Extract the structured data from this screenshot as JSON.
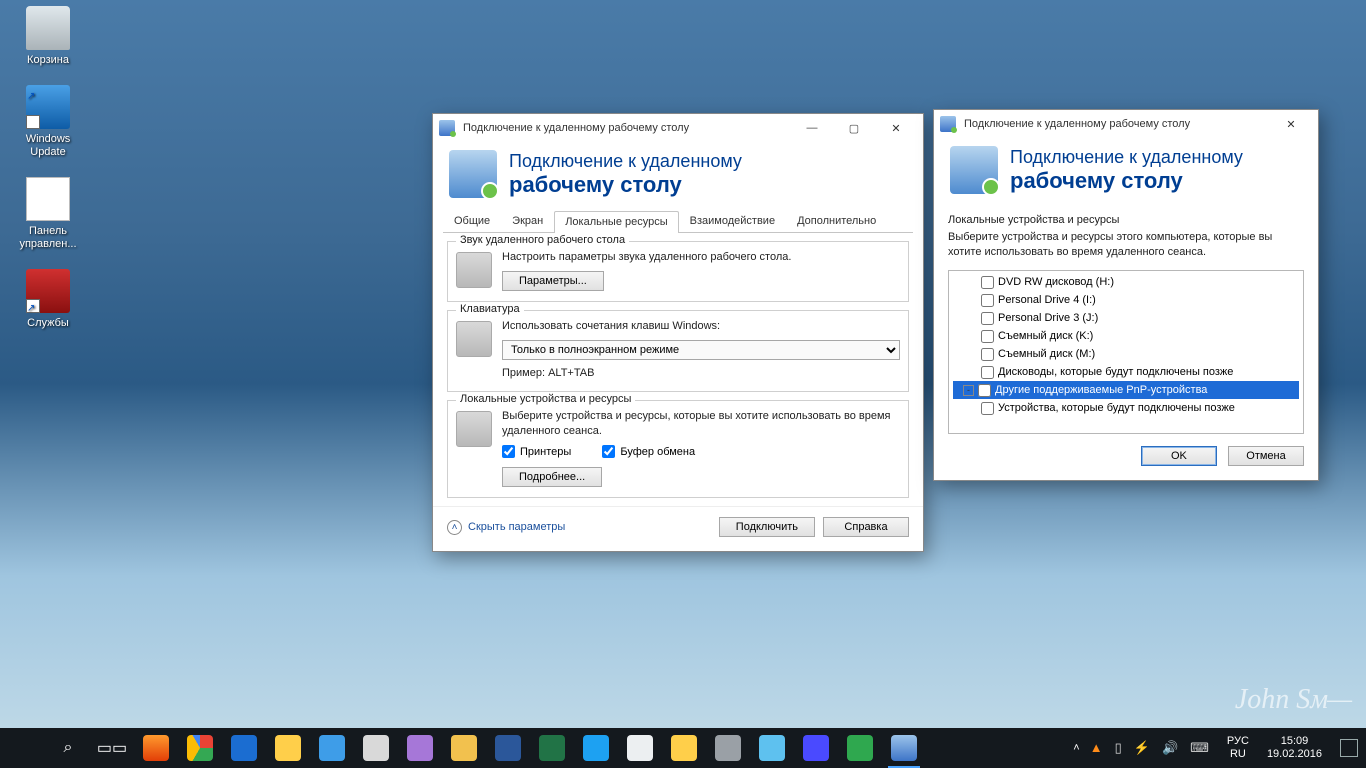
{
  "desktop": {
    "icons": [
      {
        "label": "Корзина",
        "cls": "bin"
      },
      {
        "label": "Windows Update",
        "cls": "wu shortcut"
      },
      {
        "label": "Панель управлен...",
        "cls": "doc"
      },
      {
        "label": "Службы",
        "cls": "tool shortcut"
      }
    ]
  },
  "rdp_main": {
    "title": "Подключение к удаленному рабочему столу",
    "header_line1": "Подключение к удаленному",
    "header_line2": "рабочему столу",
    "tabs": [
      "Общие",
      "Экран",
      "Локальные ресурсы",
      "Взаимодействие",
      "Дополнительно"
    ],
    "active_tab": 2,
    "group_audio": {
      "title": "Звук удаленного рабочего стола",
      "desc": "Настроить параметры звука удаленного рабочего стола.",
      "button": "Параметры..."
    },
    "group_keyboard": {
      "title": "Клавиатура",
      "desc": "Использовать сочетания клавиш Windows:",
      "select": "Только в полноэкранном режиме",
      "example": "Пример: ALT+TAB"
    },
    "group_local": {
      "title": "Локальные устройства и ресурсы",
      "desc": "Выберите устройства и ресурсы, которые вы хотите использовать во время удаленного сеанса.",
      "chk_printers": "Принтеры",
      "chk_clipboard": "Буфер обмена",
      "button": "Подробнее..."
    },
    "expand_label": "Скрыть параметры",
    "btn_connect": "Подключить",
    "btn_help": "Справка"
  },
  "rdp_more": {
    "title": "Подключение к удаленному рабочему столу",
    "header_line1": "Подключение к удаленному",
    "header_line2": "рабочему столу",
    "group_title": "Локальные устройства и ресурсы",
    "instr": "Выберите устройства и ресурсы этого компьютера, которые вы хотите использовать во время удаленного сеанса.",
    "nodes": [
      {
        "label": "DVD RW дисковод (H:)",
        "level": 1
      },
      {
        "label": "Personal Drive 4 (I:)",
        "level": 1
      },
      {
        "label": "Personal Drive 3 (J:)",
        "level": 1
      },
      {
        "label": "Съемный диск (K:)",
        "level": 1
      },
      {
        "label": "Съемный диск (M:)",
        "level": 1
      },
      {
        "label": "Дисководы, которые будут подключены позже",
        "level": 1
      },
      {
        "label": "Другие поддерживаемые PnP-устройства",
        "level": 0,
        "selected": true,
        "expander": "-"
      },
      {
        "label": "Устройства, которые будут подключены позже",
        "level": 1
      }
    ],
    "btn_ok": "OK",
    "btn_cancel": "Отмена"
  },
  "taskbar": {
    "apps": [
      {
        "name": "firefox-icon",
        "cls": "c-ff"
      },
      {
        "name": "chrome-icon",
        "cls": "c-ch"
      },
      {
        "name": "ie-icon",
        "cls": "c-ie"
      },
      {
        "name": "file-explorer-icon",
        "cls": "c-fe"
      },
      {
        "name": "totalcmd-icon",
        "cls": "c-tc"
      },
      {
        "name": "paint-icon",
        "cls": "c-pt"
      },
      {
        "name": "onenote-icon",
        "cls": "c-sn"
      },
      {
        "name": "outlook-icon",
        "cls": "c-ou"
      },
      {
        "name": "word-icon",
        "cls": "c-wd"
      },
      {
        "name": "excel-icon",
        "cls": "c-xl"
      },
      {
        "name": "skype-icon",
        "cls": "c-n1"
      },
      {
        "name": "notepad-icon",
        "cls": "c-n2"
      },
      {
        "name": "app-icon",
        "cls": "c-n3"
      },
      {
        "name": "settings-icon",
        "cls": "c-n4"
      },
      {
        "name": "mail-icon",
        "cls": "c-n5"
      },
      {
        "name": "telegram-icon",
        "cls": "c-n6"
      },
      {
        "name": "vpn-icon",
        "cls": "c-n7"
      },
      {
        "name": "rdp-icon",
        "cls": "c-rdp",
        "active": true
      }
    ],
    "lang1": "РУС",
    "lang2": "RU",
    "time": "15:09",
    "date": "19.02.2016"
  },
  "signature": "John Sᴍ—"
}
